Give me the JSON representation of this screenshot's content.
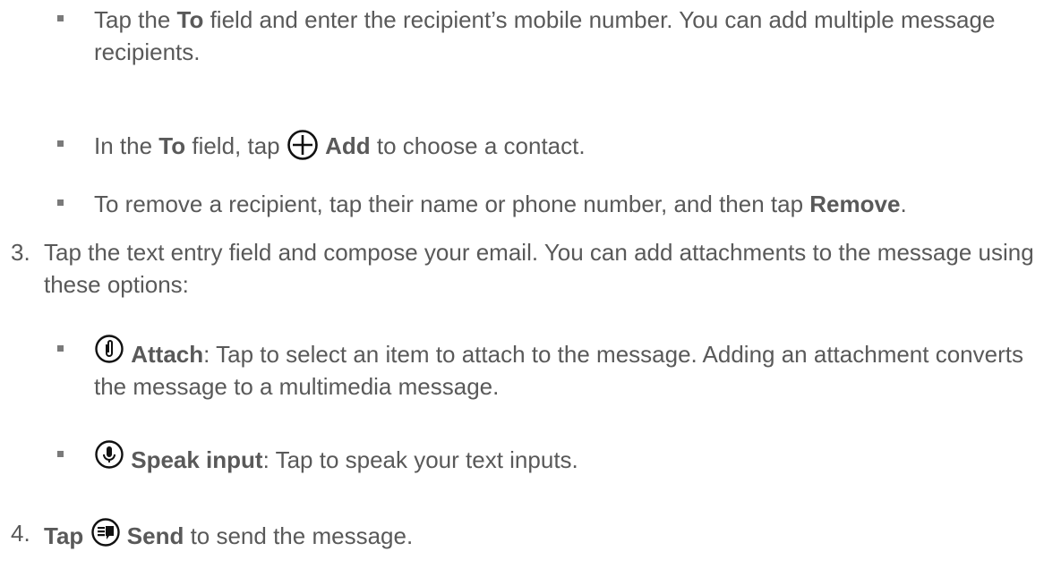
{
  "steps": {
    "to_field": {
      "pre": "Tap the ",
      "bold": "To",
      "post": " field and enter the recipient’s mobile number. You can add multiple message recipients."
    },
    "add_contact": {
      "pre": "In the ",
      "bold_to": "To",
      "mid": " field, tap ",
      "icon": "plus-circle-icon",
      "bold_add": "Add",
      "post": " to choose a contact."
    },
    "remove": {
      "pre": "To remove a recipient, tap their name or phone number, and then tap ",
      "bold": "Remove",
      "post": "."
    },
    "step3": {
      "number": "3.",
      "text": "Tap the text entry field and compose your email. You can add attachments to the message using these options:"
    },
    "attach": {
      "icon": "paperclip-icon",
      "bold": "Attach",
      "post": ": Tap to select an item to attach to the message. Adding an attachment converts the message to a multimedia message."
    },
    "speak": {
      "icon": "microphone-icon",
      "bold": "Speak input",
      "post": ": Tap to speak your text inputs."
    },
    "step4": {
      "number": "4.",
      "bold_tap": "Tap",
      "icon": "send-icon",
      "bold_send": "Send",
      "post": " to send the message."
    }
  }
}
